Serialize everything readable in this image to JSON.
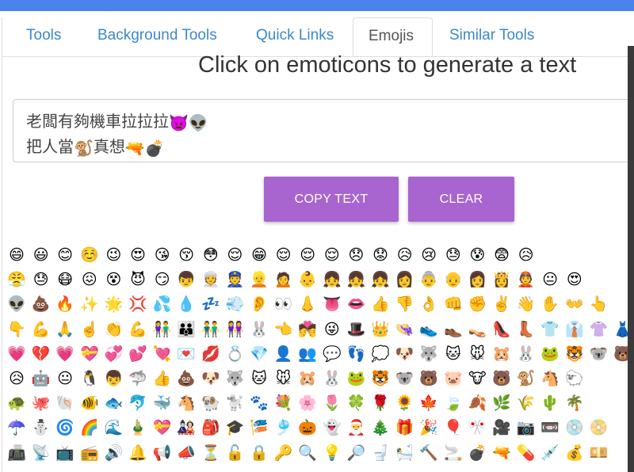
{
  "tabs": [
    {
      "label": "Tools",
      "active": false
    },
    {
      "label": "Background Tools",
      "active": false
    },
    {
      "label": "Quick Links",
      "active": false
    },
    {
      "label": "Emojis",
      "active": true
    },
    {
      "label": "Similar Tools",
      "active": false
    }
  ],
  "heading": "Click on emoticons to generate a text",
  "output": {
    "line1_text": "老闆有夠機車拉拉拉",
    "line1_emojis": [
      "👿",
      "👽"
    ],
    "line2_pre": "把人當",
    "line2_emoji1": "🐒",
    "line2_mid": "真想",
    "line2_emojis": [
      "🔫",
      "💣"
    ]
  },
  "buttons": {
    "copy": "COPY TEXT",
    "clear": "CLEAR"
  },
  "emoji_rows": [
    [
      "😄",
      "😃",
      "😊",
      "☺️",
      "😉",
      "😍",
      "😘",
      "😚",
      "😳",
      "😌",
      "😁",
      "😌",
      "😌",
      "😌",
      "😞",
      "😟",
      "😥",
      "😢",
      "😓",
      "😰",
      "😨",
      "😥"
    ],
    [
      "😤",
      "😓",
      "😷",
      "😖",
      "😵",
      "😈",
      "😏",
      "👦",
      "👳",
      "👮",
      "👱",
      "🙍",
      "👶",
      "👧",
      "👧",
      "👧",
      "👩",
      "👵",
      "👴",
      "👩",
      "👸",
      "👲",
      "😐",
      "😍"
    ],
    [
      "👽",
      "💩",
      "🔥",
      "✨",
      "🌟",
      "💢",
      "💦",
      "💧",
      "💤",
      "💨",
      "👂",
      "👀",
      "👃",
      "👅",
      "👄",
      "👍",
      "👎",
      "👌",
      "👊",
      "✊",
      "✌️",
      "👋",
      "✋",
      "👐",
      "👆"
    ],
    [
      "👇",
      "💪",
      "🙏",
      "☝️",
      "👏",
      "💪",
      "👫",
      "👪",
      "👬",
      "👭",
      "🐰",
      "👈",
      "💏",
      "😜",
      "🎩",
      "👑",
      "👒",
      "👟",
      "👞",
      "👡",
      "👠",
      "👢",
      "👕",
      "👔",
      "👚",
      "👗",
      "🎽",
      "👖",
      "👘",
      "👙",
      "💼",
      "👜",
      "🎀"
    ],
    [
      "💗",
      "💔",
      "💗",
      "💝",
      "💞",
      "💕",
      "💘",
      "💌",
      "💋",
      "💍",
      "💎",
      "👤",
      "👥",
      "💬",
      "👣",
      "💭",
      "🐶",
      "🐺",
      "🐱",
      "🐭",
      "🐹",
      "🐰",
      "🐸",
      "🐯",
      "🐨",
      "🐻",
      "🐷",
      "🐽",
      "🐮",
      "🐗",
      "🐵",
      "🐒",
      "🐴",
      "🐑",
      "🐘",
      "🐼",
      "🐧",
      "🐦",
      "🐤",
      "🐥",
      "🐣",
      "🐔",
      "🐍",
      "🐢",
      "🐛",
      "🐝",
      "🐜",
      "🐞",
      "🐌",
      "🐙",
      "🐚",
      "🐠",
      "🐟",
      "🐬",
      "🐳",
      "🐋",
      "🐄",
      "🐏",
      "🐀",
      "🐃",
      "🐅",
      "🐇",
      "🐉",
      "🐎",
      "🐐",
      "🐓",
      "🐕",
      "🐖",
      "🐁",
      "🐂",
      "🐲",
      "🐡",
      "🐊",
      "🐫",
      "🐪",
      "🐆",
      "🐈",
      "🐩",
      "🐾",
      "💐",
      "🌸",
      "🌷",
      "🍀",
      "🌹",
      "🌻",
      "🌺",
      "🍁",
      "🍃",
      "🍂",
      "🌿",
      "🌾",
      "🍄",
      "🌵",
      "🌴"
    ],
    [
      "😥",
      "🤖",
      "😐",
      "🐧",
      "👦",
      "🦈",
      "👍",
      "💩",
      "🐶",
      "🐺",
      "🐱",
      "🐭",
      "🐹",
      "🐰",
      "🐸",
      "🐯",
      "🐨",
      "🐻",
      "🐷",
      "🐮",
      "🐻",
      "🐒",
      "🐴",
      "🐑"
    ],
    [
      "🐢",
      "🐙",
      "🐚",
      "🐠",
      "🐟",
      "🐬",
      "🐳",
      "🐴",
      "🐏",
      "🐩",
      "🐾",
      "💐",
      "🌸",
      "🌷",
      "🍀",
      "🌹",
      "🌻",
      "🍁",
      "🍃",
      "🍂",
      "🌿",
      "🌾",
      "🌵",
      "🌴"
    ],
    [
      "☂️",
      "⛄",
      "🌀",
      "🌈",
      "🌊",
      "🎍",
      "💝",
      "🎎",
      "🎒",
      "🎓",
      "🎏",
      "🎐",
      "🎃",
      "👻",
      "🎅",
      "🎄",
      "🎁",
      "🎉",
      "🎈",
      "🎌",
      "🎥",
      "📷",
      "📼",
      "💿",
      "📀"
    ],
    [
      "📠",
      "📡",
      "📺",
      "📻",
      "🔊",
      "🔔",
      "📢",
      "📣",
      "⏳",
      "🔓",
      "🔒",
      "🔑",
      "🔍",
      "💡",
      "🔎",
      "🚽",
      "🛀",
      "🔨",
      "🚬",
      "💣",
      "🔫",
      "💊",
      "💉",
      "💰",
      "💴"
    ]
  ]
}
